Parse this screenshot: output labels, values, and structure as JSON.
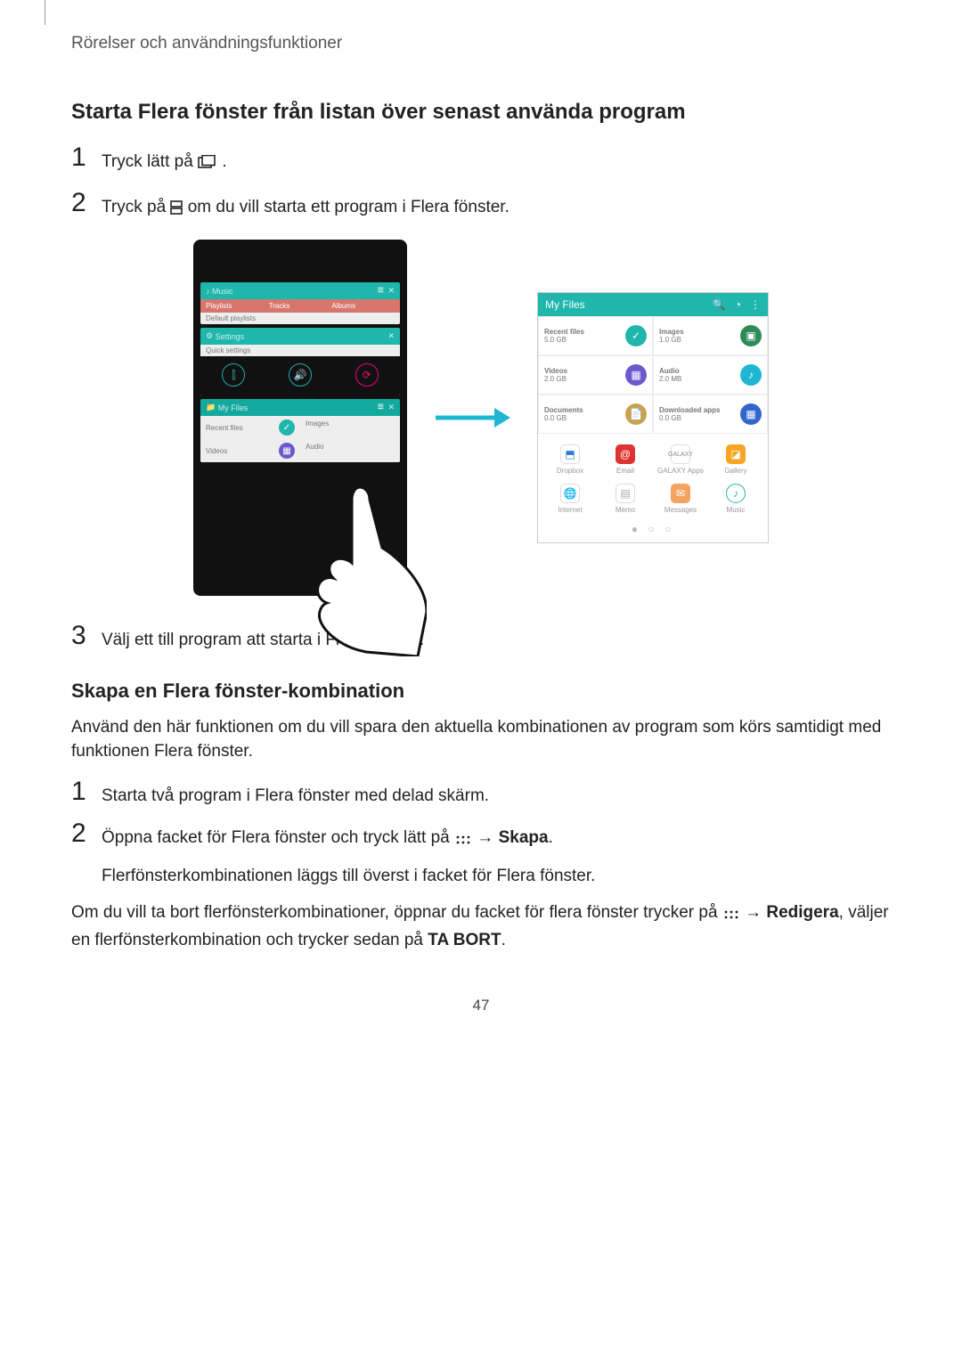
{
  "breadcrumb": "Rörelser och användningsfunktioner",
  "section1_title": "Starta Flera fönster från listan över senast använda program",
  "step1": {
    "num": "1",
    "pre": "Tryck lätt på ",
    "post": "."
  },
  "step2": {
    "num": "2",
    "pre": "Tryck på ",
    "post": " om du vill starta ett program i Flera fönster."
  },
  "step3": {
    "num": "3",
    "text": "Välj ett till program att starta i Flera fönster."
  },
  "left_phone": {
    "music": "Music",
    "settings": "Settings",
    "quick": "Quick settings",
    "myfiles": "My Files",
    "recent": "Recent files",
    "images": "Images",
    "videos": "Videos",
    "audio": "Audio"
  },
  "right_screen": {
    "title": "My Files",
    "cells": {
      "recent": "Recent files",
      "images": "Images",
      "videos": "Videos",
      "audio": "Audio",
      "documents": "Documents",
      "downloaded": "Downloaded apps"
    },
    "apps_row1": [
      "Dropbox",
      "Email",
      "GALAXY Apps",
      "Gallery"
    ],
    "apps_row2": [
      "Internet",
      "Memo",
      "Messages",
      "Music"
    ]
  },
  "section2_title": "Skapa en Flera fönster-kombination",
  "section2_intro": "Använd den här funktionen om du vill spara den aktuella kombinationen av program som körs samtidigt med funktionen Flera fönster.",
  "s2_step1": {
    "num": "1",
    "text": "Starta två program i Flera fönster med delad skärm."
  },
  "s2_step2": {
    "num": "2",
    "line1_pre": "Öppna facket för Flera fönster och tryck lätt på ",
    "line1_arrow": " → ",
    "line1_bold": "Skapa",
    "line1_post": ".",
    "line2": "Flerfönsterkombinationen läggs till överst i facket för Flera fönster."
  },
  "closing": {
    "pre": "Om du vill ta bort flerfönsterkombinationer, öppnar du facket för flera fönster trycker på ",
    "arrow": " → ",
    "bold1": "Redigera",
    "mid": ", väljer en flerfönsterkombination och trycker sedan på ",
    "bold2": "TA BORT",
    "post": "."
  },
  "page_number": "47"
}
